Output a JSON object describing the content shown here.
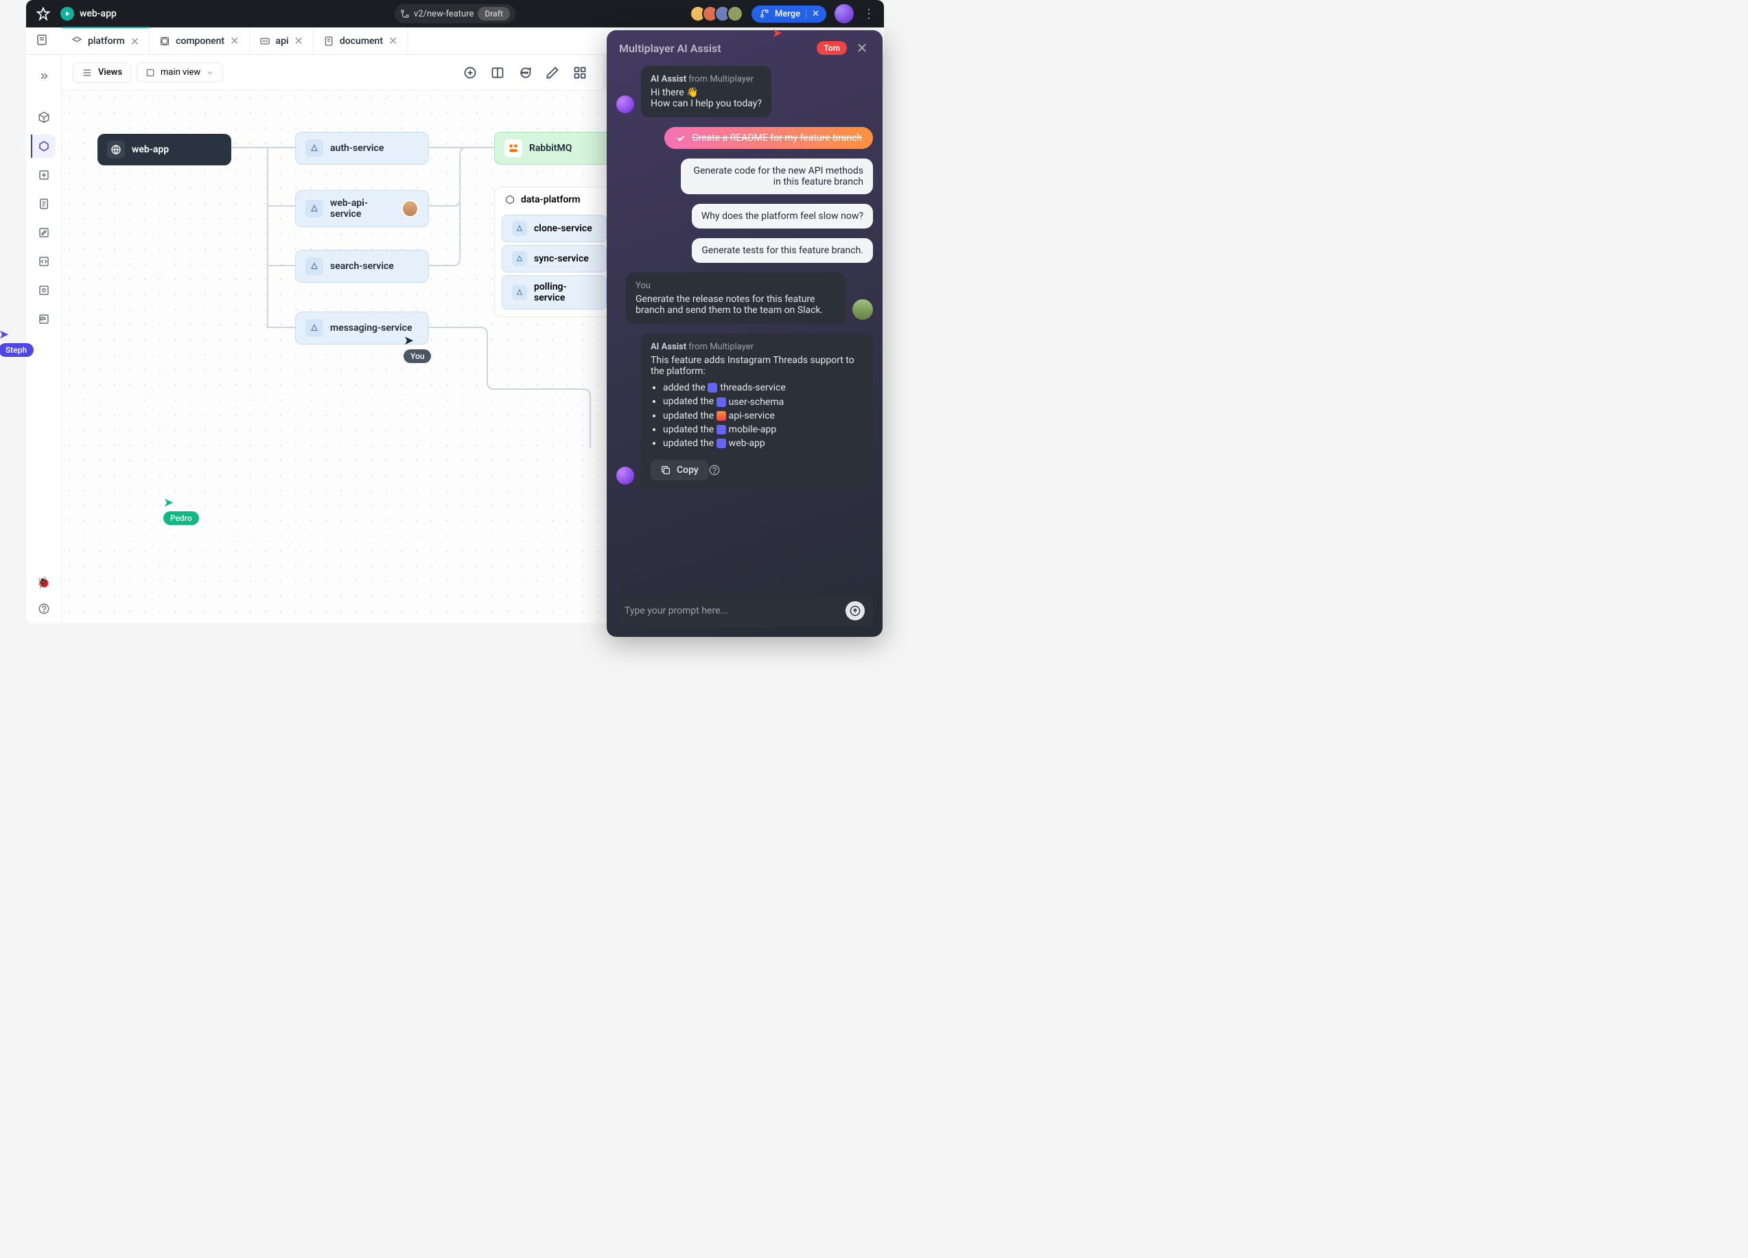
{
  "topbar": {
    "appName": "web-app",
    "branch": "v2/new-feature",
    "draft": "Draft",
    "merge": "Merge"
  },
  "tabs": [
    {
      "label": "platform"
    },
    {
      "label": "component"
    },
    {
      "label": "api"
    },
    {
      "label": "document"
    }
  ],
  "toolbar": {
    "views": "Views",
    "mainView": "main view"
  },
  "nodes": {
    "webapp": "web-app",
    "auth": "auth-service",
    "webapi": "web-api-service",
    "search": "search-service",
    "messaging": "messaging-service",
    "rabbit": "RabbitMQ",
    "group": {
      "title": "data-platform",
      "items": [
        "clone-service",
        "sync-service",
        "polling-service"
      ]
    }
  },
  "cursors": {
    "steph": "Steph",
    "pedro": "Pedro",
    "you": "You",
    "tom": "Tom"
  },
  "assist": {
    "title": "Multiplayer AI Assist",
    "msg1_from_strong": "AI Assist",
    "msg1_from_rest": "from Multiplayer",
    "msg1_l1": "Hi there 👋",
    "msg1_l2": "How can I help you today?",
    "sugg_done": "Create a README for my feature branch",
    "sugg1": "Generate code for the new API methods in this feature branch",
    "sugg2": "Why does the platform feel slow now?",
    "sugg3": "Generate tests for this feature branch.",
    "user_label": "You",
    "user_msg": "Generate the release notes for this feature branch and send them to the team on Slack.",
    "msg2_intro": "This feature adds Instagram Threads support to the platform:",
    "li1_pre": "added the",
    "li1_chip": "threads-service",
    "li2_pre": "updated the",
    "li2_chip": "user-schema",
    "li3_pre": "updated the",
    "li3_chip": "api-service",
    "li4_pre": "updated the",
    "li4_chip": "mobile-app",
    "li5_pre": "updated the",
    "li5_chip": "web-app",
    "copy": "Copy",
    "placeholder": "Type your prompt here..."
  }
}
